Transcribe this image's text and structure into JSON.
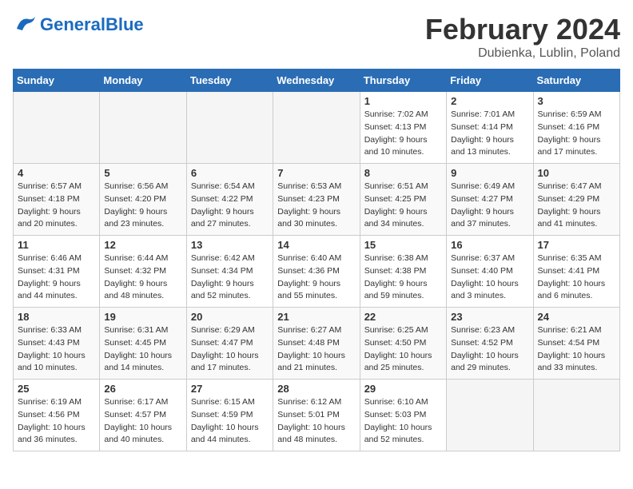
{
  "logo": {
    "brand1": "General",
    "brand2": "Blue"
  },
  "title": "February 2024",
  "subtitle": "Dubienka, Lublin, Poland",
  "weekdays": [
    "Sunday",
    "Monday",
    "Tuesday",
    "Wednesday",
    "Thursday",
    "Friday",
    "Saturday"
  ],
  "weeks": [
    [
      {
        "day": "",
        "info": ""
      },
      {
        "day": "",
        "info": ""
      },
      {
        "day": "",
        "info": ""
      },
      {
        "day": "",
        "info": ""
      },
      {
        "day": "1",
        "info": "Sunrise: 7:02 AM\nSunset: 4:13 PM\nDaylight: 9 hours\nand 10 minutes."
      },
      {
        "day": "2",
        "info": "Sunrise: 7:01 AM\nSunset: 4:14 PM\nDaylight: 9 hours\nand 13 minutes."
      },
      {
        "day": "3",
        "info": "Sunrise: 6:59 AM\nSunset: 4:16 PM\nDaylight: 9 hours\nand 17 minutes."
      }
    ],
    [
      {
        "day": "4",
        "info": "Sunrise: 6:57 AM\nSunset: 4:18 PM\nDaylight: 9 hours\nand 20 minutes."
      },
      {
        "day": "5",
        "info": "Sunrise: 6:56 AM\nSunset: 4:20 PM\nDaylight: 9 hours\nand 23 minutes."
      },
      {
        "day": "6",
        "info": "Sunrise: 6:54 AM\nSunset: 4:22 PM\nDaylight: 9 hours\nand 27 minutes."
      },
      {
        "day": "7",
        "info": "Sunrise: 6:53 AM\nSunset: 4:23 PM\nDaylight: 9 hours\nand 30 minutes."
      },
      {
        "day": "8",
        "info": "Sunrise: 6:51 AM\nSunset: 4:25 PM\nDaylight: 9 hours\nand 34 minutes."
      },
      {
        "day": "9",
        "info": "Sunrise: 6:49 AM\nSunset: 4:27 PM\nDaylight: 9 hours\nand 37 minutes."
      },
      {
        "day": "10",
        "info": "Sunrise: 6:47 AM\nSunset: 4:29 PM\nDaylight: 9 hours\nand 41 minutes."
      }
    ],
    [
      {
        "day": "11",
        "info": "Sunrise: 6:46 AM\nSunset: 4:31 PM\nDaylight: 9 hours\nand 44 minutes."
      },
      {
        "day": "12",
        "info": "Sunrise: 6:44 AM\nSunset: 4:32 PM\nDaylight: 9 hours\nand 48 minutes."
      },
      {
        "day": "13",
        "info": "Sunrise: 6:42 AM\nSunset: 4:34 PM\nDaylight: 9 hours\nand 52 minutes."
      },
      {
        "day": "14",
        "info": "Sunrise: 6:40 AM\nSunset: 4:36 PM\nDaylight: 9 hours\nand 55 minutes."
      },
      {
        "day": "15",
        "info": "Sunrise: 6:38 AM\nSunset: 4:38 PM\nDaylight: 9 hours\nand 59 minutes."
      },
      {
        "day": "16",
        "info": "Sunrise: 6:37 AM\nSunset: 4:40 PM\nDaylight: 10 hours\nand 3 minutes."
      },
      {
        "day": "17",
        "info": "Sunrise: 6:35 AM\nSunset: 4:41 PM\nDaylight: 10 hours\nand 6 minutes."
      }
    ],
    [
      {
        "day": "18",
        "info": "Sunrise: 6:33 AM\nSunset: 4:43 PM\nDaylight: 10 hours\nand 10 minutes."
      },
      {
        "day": "19",
        "info": "Sunrise: 6:31 AM\nSunset: 4:45 PM\nDaylight: 10 hours\nand 14 minutes."
      },
      {
        "day": "20",
        "info": "Sunrise: 6:29 AM\nSunset: 4:47 PM\nDaylight: 10 hours\nand 17 minutes."
      },
      {
        "day": "21",
        "info": "Sunrise: 6:27 AM\nSunset: 4:48 PM\nDaylight: 10 hours\nand 21 minutes."
      },
      {
        "day": "22",
        "info": "Sunrise: 6:25 AM\nSunset: 4:50 PM\nDaylight: 10 hours\nand 25 minutes."
      },
      {
        "day": "23",
        "info": "Sunrise: 6:23 AM\nSunset: 4:52 PM\nDaylight: 10 hours\nand 29 minutes."
      },
      {
        "day": "24",
        "info": "Sunrise: 6:21 AM\nSunset: 4:54 PM\nDaylight: 10 hours\nand 33 minutes."
      }
    ],
    [
      {
        "day": "25",
        "info": "Sunrise: 6:19 AM\nSunset: 4:56 PM\nDaylight: 10 hours\nand 36 minutes."
      },
      {
        "day": "26",
        "info": "Sunrise: 6:17 AM\nSunset: 4:57 PM\nDaylight: 10 hours\nand 40 minutes."
      },
      {
        "day": "27",
        "info": "Sunrise: 6:15 AM\nSunset: 4:59 PM\nDaylight: 10 hours\nand 44 minutes."
      },
      {
        "day": "28",
        "info": "Sunrise: 6:12 AM\nSunset: 5:01 PM\nDaylight: 10 hours\nand 48 minutes."
      },
      {
        "day": "29",
        "info": "Sunrise: 6:10 AM\nSunset: 5:03 PM\nDaylight: 10 hours\nand 52 minutes."
      },
      {
        "day": "",
        "info": ""
      },
      {
        "day": "",
        "info": ""
      }
    ]
  ]
}
